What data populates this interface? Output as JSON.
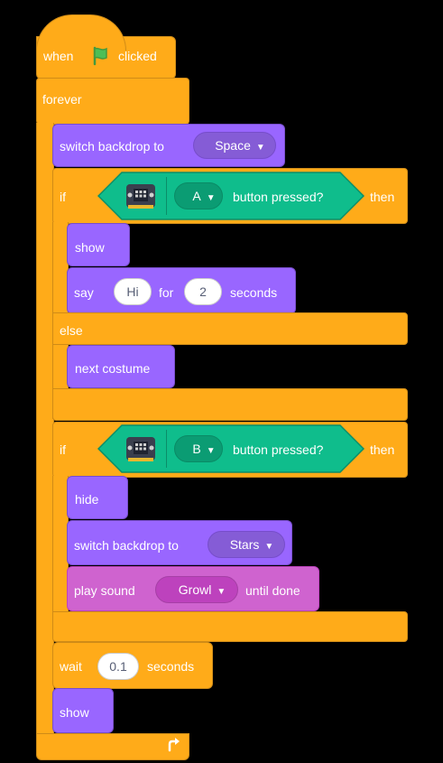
{
  "script": {
    "hat": {
      "when": "when",
      "clicked": "clicked",
      "flag_icon": "green-flag-icon"
    },
    "forever_label": "forever",
    "switch_backdrop_1": {
      "label": "switch backdrop to",
      "value": "Space"
    },
    "if1": {
      "if_label": "if",
      "then_label": "then",
      "button": "A",
      "sensor_label": "button pressed?",
      "device_icon": "microbit-icon"
    },
    "show_1": "show",
    "say": {
      "label": "say",
      "text": "Hi",
      "for_label": "for",
      "seconds": "2",
      "seconds_label": "seconds"
    },
    "else_label": "else",
    "next_costume": "next costume",
    "if2": {
      "if_label": "if",
      "then_label": "then",
      "button": "B",
      "sensor_label": "button pressed?",
      "device_icon": "microbit-icon"
    },
    "hide": "hide",
    "switch_backdrop_2": {
      "label": "switch backdrop to",
      "value": "Stars"
    },
    "play_sound": {
      "label": "play sound",
      "value": "Growl",
      "suffix": "until done"
    },
    "wait": {
      "label": "wait",
      "value": "0.1",
      "suffix": "seconds"
    },
    "show_2": "show",
    "loop_icon": "loop-arrow-icon"
  },
  "colors": {
    "events": "#FFAB19",
    "control": "#FFAB19",
    "looks": "#9966FF",
    "sound": "#CF63CF",
    "extension": "#0FBD8C",
    "background": "#000000"
  }
}
